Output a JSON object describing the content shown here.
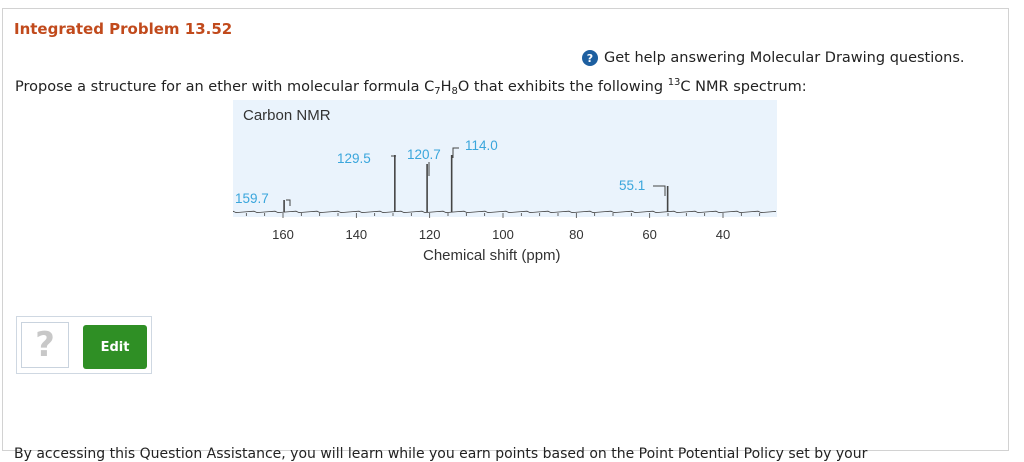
{
  "problem": {
    "title": "Integrated Problem 13.52"
  },
  "help": {
    "icon": "question-circle-icon",
    "link_text": "Get help answering Molecular Drawing questions."
  },
  "prompt": {
    "part1": "Propose a structure for an ether with molecular formula C",
    "sub1": "7",
    "part2": "H",
    "sub2": "8",
    "part3": "O that exhibits the following ",
    "sup": "13",
    "part4": "C NMR spectrum:"
  },
  "nmr": {
    "title": "Carbon NMR",
    "xlabel": "Chemical shift (ppm)",
    "ticks": [
      "160",
      "140",
      "120",
      "100",
      "80",
      "60",
      "40"
    ],
    "peaks": [
      {
        "label": "159.7",
        "ppm": 159.7
      },
      {
        "label": "129.5",
        "ppm": 129.5
      },
      {
        "label": "120.7",
        "ppm": 120.7
      },
      {
        "label": "114.0",
        "ppm": 114.0
      },
      {
        "label": "55.1",
        "ppm": 55.1
      }
    ],
    "colors": {
      "label": "#3aa6dc",
      "bg": "#eaf3fc",
      "line": "#444444"
    }
  },
  "answer": {
    "placeholder_glyph": "?",
    "edit_label": "Edit"
  },
  "footer": {
    "text": "By accessing this Question Assistance, you will learn while you earn points based on the Point Potential Policy set by your"
  }
}
